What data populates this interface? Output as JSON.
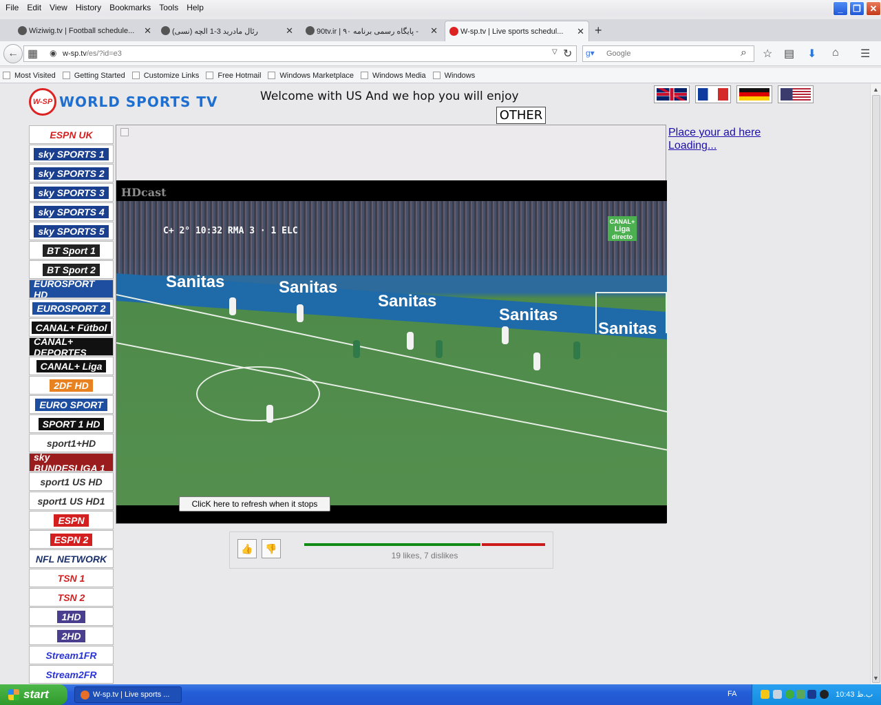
{
  "menu": [
    "File",
    "Edit",
    "View",
    "History",
    "Bookmarks",
    "Tools",
    "Help"
  ],
  "tabs": [
    {
      "title": "Wiziwig.tv | Football schedule...",
      "active": false
    },
    {
      "title": "(نسی) رئال مادرید 3-1 الچه",
      "active": false
    },
    {
      "title": "90tv.ir | ۹۰ پایگاه رسمی برنامه -",
      "active": false
    },
    {
      "title": "W-sp.tv | Live sports schedul...",
      "active": true
    }
  ],
  "url": {
    "host": "w-sp.tv",
    "path": "/es/?id=e3"
  },
  "search": {
    "placeholder": "Google"
  },
  "bookmarks": [
    "Most Visited",
    "Getting Started",
    "Customize Links",
    "Free Hotmail",
    "Windows Marketplace",
    "Windows Media",
    "Windows"
  ],
  "site": {
    "logo_badge": "W-SP",
    "logo_text": "WORLD SPORTS TV",
    "welcome": "Welcome with US And we hop you will enjoy",
    "other_button": "OTHER",
    "ad_line1": "Place your ad here",
    "ad_line2": "Loading..."
  },
  "flags": [
    {
      "name": "uk-flag"
    },
    {
      "name": "france-flag"
    },
    {
      "name": "germany-flag"
    },
    {
      "name": "usa-flag"
    }
  ],
  "channels": [
    {
      "label": "ESPN UK",
      "color": "#d31f1f",
      "bg": "#ffffff"
    },
    {
      "label": "sky SPORTS 1",
      "color": "#ffffff",
      "bg": "#1b3f8f"
    },
    {
      "label": "sky SPORTS 2",
      "color": "#ffffff",
      "bg": "#1b3f8f"
    },
    {
      "label": "sky SPORTS 3",
      "color": "#ffffff",
      "bg": "#1b3f8f"
    },
    {
      "label": "sky SPORTS 4",
      "color": "#ffffff",
      "bg": "#1b3f8f"
    },
    {
      "label": "sky SPORTS 5",
      "color": "#ffffff",
      "bg": "#1b3f8f"
    },
    {
      "label": "BT Sport 1",
      "color": "#ffffff",
      "bg": "#222222"
    },
    {
      "label": "BT Sport 2",
      "color": "#ffffff",
      "bg": "#222222"
    },
    {
      "label": "EUROSPORT HD",
      "color": "#ffffff",
      "bg": "#1d4ea0"
    },
    {
      "label": "EUROSPORT 2",
      "color": "#ffffff",
      "bg": "#1d4ea0"
    },
    {
      "label": "CANAL+ Fútbol",
      "color": "#ffffff",
      "bg": "#111111"
    },
    {
      "label": "CANAL+ DEPORTES",
      "color": "#ffffff",
      "bg": "#111111"
    },
    {
      "label": "CANAL+ Liga",
      "color": "#ffffff",
      "bg": "#111111"
    },
    {
      "label": "2DF HD",
      "color": "#ffffff",
      "bg": "#e8811f"
    },
    {
      "label": "EURO SPORT",
      "color": "#ffffff",
      "bg": "#1d4ea0"
    },
    {
      "label": "SPORT 1 HD",
      "color": "#ffffff",
      "bg": "#111111"
    },
    {
      "label": "sport1+HD",
      "color": "#333333",
      "bg": "#ffffff"
    },
    {
      "label": "sky BUNDESLIGA 1",
      "color": "#ffffff",
      "bg": "#9a1c1c"
    },
    {
      "label": "sport1 US HD",
      "color": "#333333",
      "bg": "#ffffff"
    },
    {
      "label": "sport1 US HD1",
      "color": "#333333",
      "bg": "#ffffff"
    },
    {
      "label": "ESPN",
      "color": "#ffffff",
      "bg": "#d31f1f"
    },
    {
      "label": "ESPN 2",
      "color": "#ffffff",
      "bg": "#d31f1f"
    },
    {
      "label": "NFL NETWORK",
      "color": "#1b2f6b",
      "bg": "#ffffff"
    },
    {
      "label": "TSN 1",
      "color": "#d31f1f",
      "bg": "#ffffff"
    },
    {
      "label": "TSN 2",
      "color": "#d31f1f",
      "bg": "#ffffff"
    },
    {
      "label": "1HD",
      "color": "#ffffff",
      "bg": "#4a3f8f"
    },
    {
      "label": "2HD",
      "color": "#ffffff",
      "bg": "#4a3f8f"
    },
    {
      "label": "Stream1FR",
      "color": "#2a34d8",
      "bg": "#ffffff"
    },
    {
      "label": "Stream2FR",
      "color": "#2a34d8",
      "bg": "#ffffff"
    }
  ],
  "player": {
    "provider": "HDcast",
    "score": "C+  2°  10:32  RMA  3 · 1  ELC",
    "broadcaster_line1": "CANAL+",
    "broadcaster_line2": "Liga",
    "broadcaster_line3": "directo",
    "sponsor": "Sanitas",
    "refresh_label": "ClicK here to refresh when it stops"
  },
  "rating": {
    "likes": 19,
    "dislikes": 7,
    "summary": "19 likes, 7 dislikes",
    "like_color": "#138a13",
    "dislike_color": "#cc1a1a"
  },
  "taskbar": {
    "start_label": "start",
    "window_title": "W-sp.tv | Live sports ...",
    "language": "FA",
    "clock": "10:43 ب.ظ"
  }
}
